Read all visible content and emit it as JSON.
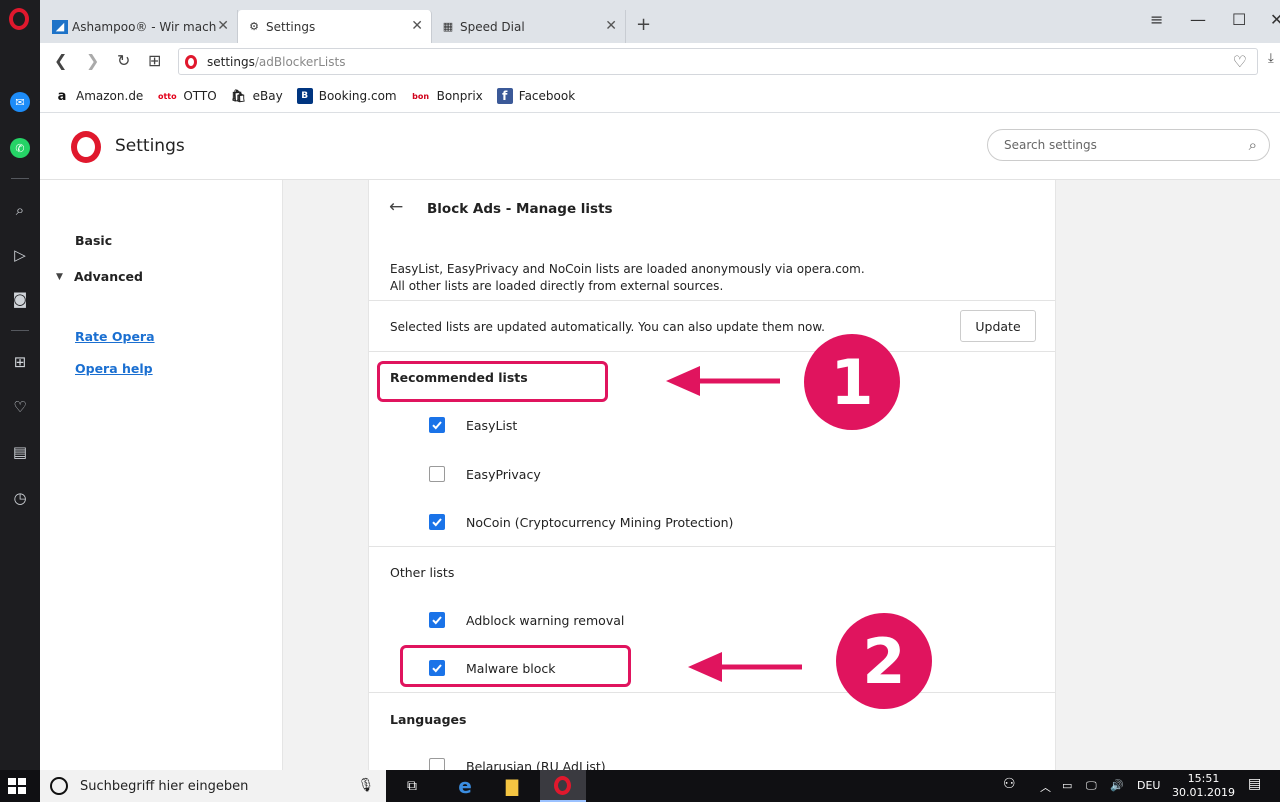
{
  "browser": {
    "tabs": [
      {
        "label": "Ashampoo® - Wir macher",
        "icon": "ashampoo-icon"
      },
      {
        "label": "Settings",
        "icon": "gear-icon"
      },
      {
        "label": "Speed Dial",
        "icon": "grid-icon"
      }
    ],
    "address": {
      "host": "settings",
      "path": "/adBlockerLists"
    },
    "bookmarks": [
      {
        "label": "Amazon.de",
        "icon_text": "a"
      },
      {
        "label": "OTTO",
        "icon_text": "otto"
      },
      {
        "label": "eBay",
        "icon_text": "🛍"
      },
      {
        "label": "Booking.com",
        "icon_text": "B"
      },
      {
        "label": "Bonprix",
        "icon_text": "bon"
      },
      {
        "label": "Facebook",
        "icon_text": "f"
      }
    ]
  },
  "settings": {
    "title": "Settings",
    "search_placeholder": "Search settings",
    "nav": {
      "basic": "Basic",
      "advanced": "Advanced",
      "rate": "Rate Opera",
      "help": "Opera help"
    },
    "page": {
      "title": "Block Ads - Manage lists",
      "info_line1": "EasyList, EasyPrivacy and NoCoin lists are loaded anonymously via opera.com.",
      "info_line2": "All other lists are loaded directly from external sources.",
      "update_text": "Selected lists are updated automatically. You can also update them now.",
      "update_button": "Update",
      "recommended_heading": "Recommended lists",
      "recommended": [
        {
          "label": "EasyList",
          "checked": true
        },
        {
          "label": "EasyPrivacy",
          "checked": false
        },
        {
          "label": "NoCoin (Cryptocurrency Mining Protection)",
          "checked": true
        }
      ],
      "other_heading": "Other lists",
      "other": [
        {
          "label": "Adblock warning removal",
          "checked": true
        },
        {
          "label": "Malware block",
          "checked": true
        }
      ],
      "languages_heading": "Languages",
      "languages": [
        {
          "label": "Belarusian (RU AdList)",
          "checked": false
        }
      ]
    }
  },
  "annotations": {
    "marker1": "1",
    "marker2": "2",
    "color": "#e0145e"
  },
  "taskbar": {
    "search_text": "Suchbegriff hier eingeben",
    "language": "DEU",
    "time": "15:51",
    "date": "30.01.2019"
  }
}
